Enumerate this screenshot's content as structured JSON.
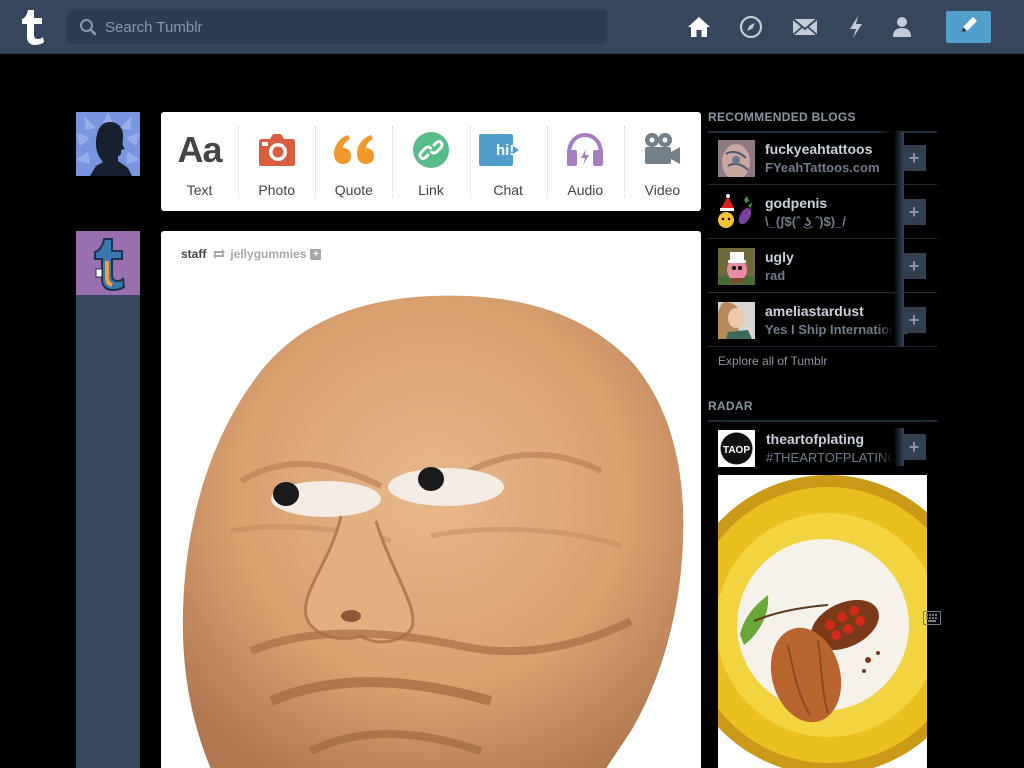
{
  "header": {
    "search_placeholder": "Search Tumblr",
    "nav": [
      "home-icon",
      "explore-compass-icon",
      "inbox-envelope-icon",
      "activity-lightning-icon",
      "account-person-icon"
    ],
    "compose_icon": "pencil-icon",
    "colors": {
      "bar": "#36465d",
      "compose": "#529ecc"
    }
  },
  "post_types": [
    {
      "label": "Text",
      "icon": "Aa",
      "color": "#444444"
    },
    {
      "label": "Photo",
      "icon": "camera-icon",
      "color": "#d95e40"
    },
    {
      "label": "Quote",
      "icon": "quote-icon",
      "color": "#f2992e"
    },
    {
      "label": "Link",
      "icon": "link-icon",
      "color": "#56bc8a"
    },
    {
      "label": "Chat",
      "icon": "chat-icon",
      "text": "hi!",
      "color": "#529ecc"
    },
    {
      "label": "Audio",
      "icon": "headphones-icon",
      "color": "#a77dc2"
    },
    {
      "label": "Video",
      "icon": "video-camera-icon",
      "color": "#748089"
    }
  ],
  "post": {
    "author": "staff",
    "reblogged_from": "jellygummies",
    "follow_symbol": "+"
  },
  "sidebar": {
    "recommended_title": "RECOMMENDED BLOGS",
    "recommended": [
      {
        "name": "fuckyeahtattoos",
        "title": "FYeahTattoos.com"
      },
      {
        "name": "godpenis",
        "title": "\\_(ʃ$(ˆ ͜ʖ ˆ)$)_/"
      },
      {
        "name": "ugly",
        "title": "rad"
      },
      {
        "name": "ameliastardust",
        "title": "Yes I Ship International"
      }
    ],
    "follow_symbol": "+",
    "explore_label": "Explore all of Tumblr",
    "radar_title": "RADAR",
    "radar": {
      "name": "theartofplating",
      "tag": "#THEARTOFPLATING",
      "avatar_text": "TAOP"
    }
  }
}
